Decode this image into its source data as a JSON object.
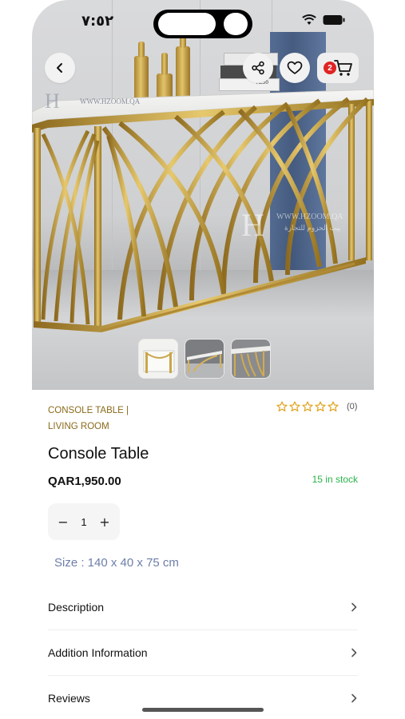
{
  "status_bar": {
    "time": "٧:٥٢"
  },
  "header": {
    "back_icon": "chevron-left-icon",
    "share_icon": "share-icon",
    "wishlist_icon": "heart-icon",
    "cart_icon": "cart-icon",
    "cart_count": "2"
  },
  "hero": {
    "watermark_url": "WWW.HZOOM.QA",
    "watermark_arabic": "بيت الحزوم للتجارة",
    "books_label": "AL50"
  },
  "thumbnails": [
    {
      "name": "thumbnail-1"
    },
    {
      "name": "thumbnail-2"
    },
    {
      "name": "thumbnail-3"
    }
  ],
  "product": {
    "category_1": "CONSOLE TABLE  |",
    "category_2": "LIVING ROOM",
    "rating_stars": 0,
    "rating_count": "(0)",
    "title": "Console Table",
    "price": "QAR1,950.00",
    "stock": "15 in stock",
    "quantity": "1",
    "qty_minus": "−",
    "qty_plus": "+",
    "size": "Size : 140 x 40 x 75 cm"
  },
  "sections": [
    {
      "label": "Description"
    },
    {
      "label": "Addition Information"
    },
    {
      "label": "Reviews"
    }
  ],
  "colors": {
    "accent_gold": "#8a6a1a",
    "stock_green": "#2bb34b",
    "size_blue": "#6d7ea9",
    "badge_red": "#e02424"
  }
}
